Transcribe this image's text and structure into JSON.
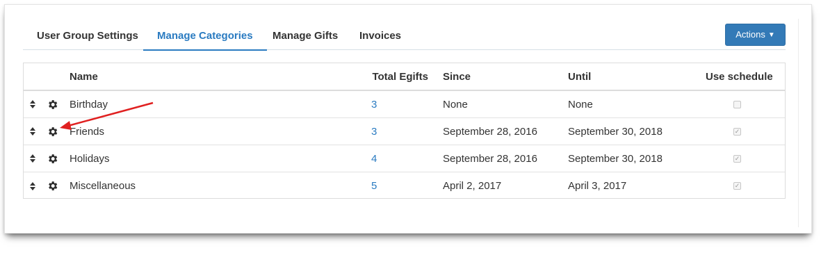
{
  "tabs": [
    {
      "label": "User Group Settings",
      "active": false
    },
    {
      "label": "Manage Categories",
      "active": true
    },
    {
      "label": "Manage Gifts",
      "active": false
    },
    {
      "label": "Invoices",
      "active": false
    }
  ],
  "actions": {
    "label": "Actions"
  },
  "table": {
    "headers": {
      "name": "Name",
      "total_egifts": "Total Egifts",
      "since": "Since",
      "until": "Until",
      "use_schedule": "Use schedule"
    },
    "rows": [
      {
        "name": "Birthday",
        "total_egifts": "3",
        "since": "None",
        "until": "None",
        "use_schedule": false
      },
      {
        "name": "Friends",
        "total_egifts": "3",
        "since": "September 28, 2016",
        "until": "September 30, 2018",
        "use_schedule": true
      },
      {
        "name": "Holidays",
        "total_egifts": "4",
        "since": "September 28, 2016",
        "until": "September 30, 2018",
        "use_schedule": true
      },
      {
        "name": "Miscellaneous",
        "total_egifts": "5",
        "since": "April 2, 2017",
        "until": "April 3, 2017",
        "use_schedule": true
      }
    ]
  },
  "icons": {
    "reorder": "sort-handle-icon",
    "settings": "gear-icon",
    "dropdown": "caret-down-icon",
    "annotation": "red-arrow"
  },
  "colors": {
    "accent": "#2a7bc1",
    "button": "#337ab7",
    "annotation_arrow": "#e02020"
  }
}
